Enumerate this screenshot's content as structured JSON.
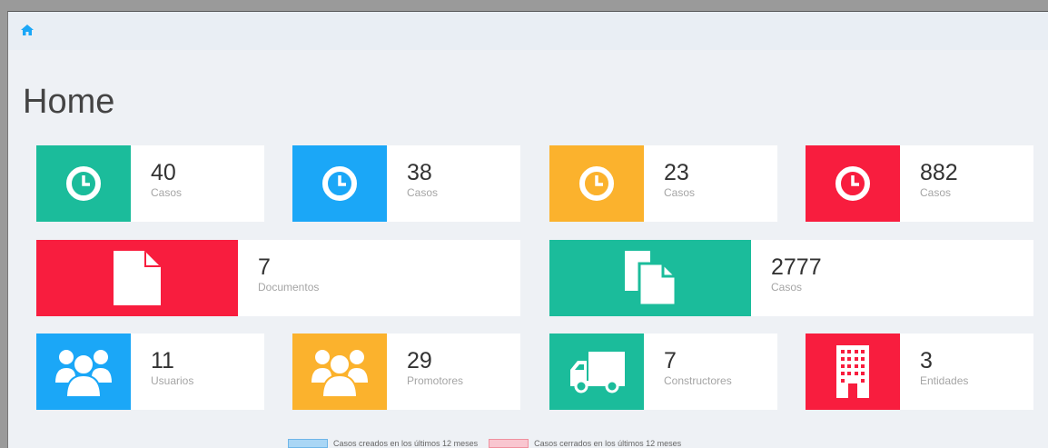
{
  "header": {
    "home_icon": "home-icon"
  },
  "page": {
    "title": "Home"
  },
  "colors": {
    "green": "#1bbc9b",
    "blue": "#1ba7f7",
    "orange": "#fbb22d",
    "red": "#f81d3e",
    "legend_created": "#a9d6f5",
    "legend_closed": "#f9c6d0"
  },
  "tiles": [
    {
      "value": "40",
      "label": "Casos",
      "icon": "clock-icon",
      "color": "green"
    },
    {
      "value": "38",
      "label": "Casos",
      "icon": "clock-icon",
      "color": "blue"
    },
    {
      "value": "23",
      "label": "Casos",
      "icon": "clock-icon",
      "color": "orange"
    },
    {
      "value": "882",
      "label": "Casos",
      "icon": "clock-icon",
      "color": "red"
    },
    {
      "value": "7",
      "label": "Documentos",
      "icon": "file-icon",
      "color": "red"
    },
    {
      "value": "2777",
      "label": "Casos",
      "icon": "copy-files-icon",
      "color": "green"
    },
    {
      "value": "11",
      "label": "Usuarios",
      "icon": "users-icon",
      "color": "blue"
    },
    {
      "value": "29",
      "label": "Promotores",
      "icon": "users-icon",
      "color": "orange"
    },
    {
      "value": "7",
      "label": "Constructores",
      "icon": "truck-icon",
      "color": "green"
    },
    {
      "value": "3",
      "label": "Entidades",
      "icon": "building-icon",
      "color": "red"
    }
  ],
  "legend": {
    "created": "Casos creados en los últimos 12 meses",
    "closed": "Casos cerrados en los últimos 12 meses"
  }
}
